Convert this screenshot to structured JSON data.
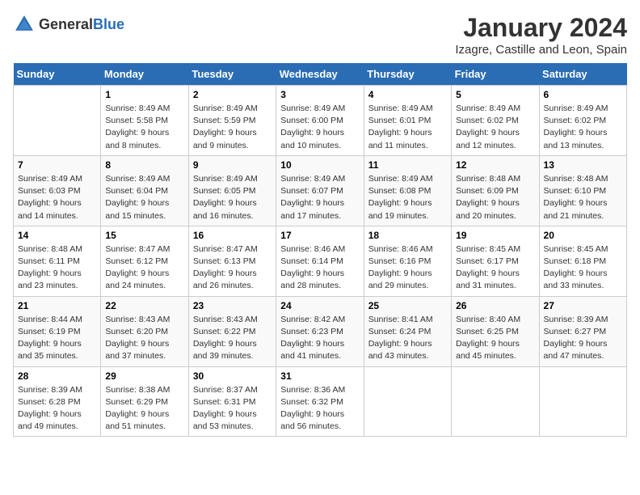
{
  "header": {
    "logo_general": "General",
    "logo_blue": "Blue",
    "title": "January 2024",
    "subtitle": "Izagre, Castille and Leon, Spain"
  },
  "days_of_week": [
    "Sunday",
    "Monday",
    "Tuesday",
    "Wednesday",
    "Thursday",
    "Friday",
    "Saturday"
  ],
  "weeks": [
    [
      null,
      {
        "day": 1,
        "sunrise": "Sunrise: 8:49 AM",
        "sunset": "Sunset: 5:58 PM",
        "daylight": "Daylight: 9 hours and 8 minutes."
      },
      {
        "day": 2,
        "sunrise": "Sunrise: 8:49 AM",
        "sunset": "Sunset: 5:59 PM",
        "daylight": "Daylight: 9 hours and 9 minutes."
      },
      {
        "day": 3,
        "sunrise": "Sunrise: 8:49 AM",
        "sunset": "Sunset: 6:00 PM",
        "daylight": "Daylight: 9 hours and 10 minutes."
      },
      {
        "day": 4,
        "sunrise": "Sunrise: 8:49 AM",
        "sunset": "Sunset: 6:01 PM",
        "daylight": "Daylight: 9 hours and 11 minutes."
      },
      {
        "day": 5,
        "sunrise": "Sunrise: 8:49 AM",
        "sunset": "Sunset: 6:02 PM",
        "daylight": "Daylight: 9 hours and 12 minutes."
      },
      {
        "day": 6,
        "sunrise": "Sunrise: 8:49 AM",
        "sunset": "Sunset: 6:02 PM",
        "daylight": "Daylight: 9 hours and 13 minutes."
      }
    ],
    [
      {
        "day": 7,
        "sunrise": "Sunrise: 8:49 AM",
        "sunset": "Sunset: 6:03 PM",
        "daylight": "Daylight: 9 hours and 14 minutes."
      },
      {
        "day": 8,
        "sunrise": "Sunrise: 8:49 AM",
        "sunset": "Sunset: 6:04 PM",
        "daylight": "Daylight: 9 hours and 15 minutes."
      },
      {
        "day": 9,
        "sunrise": "Sunrise: 8:49 AM",
        "sunset": "Sunset: 6:05 PM",
        "daylight": "Daylight: 9 hours and 16 minutes."
      },
      {
        "day": 10,
        "sunrise": "Sunrise: 8:49 AM",
        "sunset": "Sunset: 6:07 PM",
        "daylight": "Daylight: 9 hours and 17 minutes."
      },
      {
        "day": 11,
        "sunrise": "Sunrise: 8:49 AM",
        "sunset": "Sunset: 6:08 PM",
        "daylight": "Daylight: 9 hours and 19 minutes."
      },
      {
        "day": 12,
        "sunrise": "Sunrise: 8:48 AM",
        "sunset": "Sunset: 6:09 PM",
        "daylight": "Daylight: 9 hours and 20 minutes."
      },
      {
        "day": 13,
        "sunrise": "Sunrise: 8:48 AM",
        "sunset": "Sunset: 6:10 PM",
        "daylight": "Daylight: 9 hours and 21 minutes."
      }
    ],
    [
      {
        "day": 14,
        "sunrise": "Sunrise: 8:48 AM",
        "sunset": "Sunset: 6:11 PM",
        "daylight": "Daylight: 9 hours and 23 minutes."
      },
      {
        "day": 15,
        "sunrise": "Sunrise: 8:47 AM",
        "sunset": "Sunset: 6:12 PM",
        "daylight": "Daylight: 9 hours and 24 minutes."
      },
      {
        "day": 16,
        "sunrise": "Sunrise: 8:47 AM",
        "sunset": "Sunset: 6:13 PM",
        "daylight": "Daylight: 9 hours and 26 minutes."
      },
      {
        "day": 17,
        "sunrise": "Sunrise: 8:46 AM",
        "sunset": "Sunset: 6:14 PM",
        "daylight": "Daylight: 9 hours and 28 minutes."
      },
      {
        "day": 18,
        "sunrise": "Sunrise: 8:46 AM",
        "sunset": "Sunset: 6:16 PM",
        "daylight": "Daylight: 9 hours and 29 minutes."
      },
      {
        "day": 19,
        "sunrise": "Sunrise: 8:45 AM",
        "sunset": "Sunset: 6:17 PM",
        "daylight": "Daylight: 9 hours and 31 minutes."
      },
      {
        "day": 20,
        "sunrise": "Sunrise: 8:45 AM",
        "sunset": "Sunset: 6:18 PM",
        "daylight": "Daylight: 9 hours and 33 minutes."
      }
    ],
    [
      {
        "day": 21,
        "sunrise": "Sunrise: 8:44 AM",
        "sunset": "Sunset: 6:19 PM",
        "daylight": "Daylight: 9 hours and 35 minutes."
      },
      {
        "day": 22,
        "sunrise": "Sunrise: 8:43 AM",
        "sunset": "Sunset: 6:20 PM",
        "daylight": "Daylight: 9 hours and 37 minutes."
      },
      {
        "day": 23,
        "sunrise": "Sunrise: 8:43 AM",
        "sunset": "Sunset: 6:22 PM",
        "daylight": "Daylight: 9 hours and 39 minutes."
      },
      {
        "day": 24,
        "sunrise": "Sunrise: 8:42 AM",
        "sunset": "Sunset: 6:23 PM",
        "daylight": "Daylight: 9 hours and 41 minutes."
      },
      {
        "day": 25,
        "sunrise": "Sunrise: 8:41 AM",
        "sunset": "Sunset: 6:24 PM",
        "daylight": "Daylight: 9 hours and 43 minutes."
      },
      {
        "day": 26,
        "sunrise": "Sunrise: 8:40 AM",
        "sunset": "Sunset: 6:25 PM",
        "daylight": "Daylight: 9 hours and 45 minutes."
      },
      {
        "day": 27,
        "sunrise": "Sunrise: 8:39 AM",
        "sunset": "Sunset: 6:27 PM",
        "daylight": "Daylight: 9 hours and 47 minutes."
      }
    ],
    [
      {
        "day": 28,
        "sunrise": "Sunrise: 8:39 AM",
        "sunset": "Sunset: 6:28 PM",
        "daylight": "Daylight: 9 hours and 49 minutes."
      },
      {
        "day": 29,
        "sunrise": "Sunrise: 8:38 AM",
        "sunset": "Sunset: 6:29 PM",
        "daylight": "Daylight: 9 hours and 51 minutes."
      },
      {
        "day": 30,
        "sunrise": "Sunrise: 8:37 AM",
        "sunset": "Sunset: 6:31 PM",
        "daylight": "Daylight: 9 hours and 53 minutes."
      },
      {
        "day": 31,
        "sunrise": "Sunrise: 8:36 AM",
        "sunset": "Sunset: 6:32 PM",
        "daylight": "Daylight: 9 hours and 56 minutes."
      },
      null,
      null,
      null
    ]
  ]
}
